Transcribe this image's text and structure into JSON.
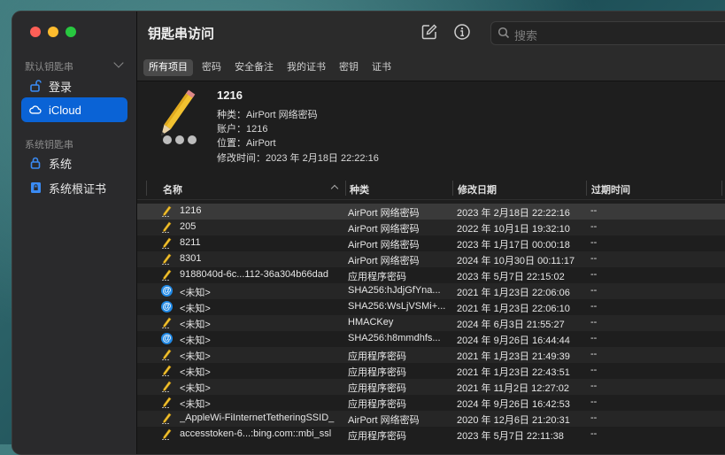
{
  "window": {
    "title": "钥匙串访问"
  },
  "sidebar": {
    "section_default": "默认钥匙串",
    "section_system": "系统钥匙串",
    "items": [
      {
        "label": "登录",
        "icon": "unlocked-lock-icon"
      },
      {
        "label": "iCloud",
        "icon": "cloud-icon",
        "selected": true
      },
      {
        "label": "系统",
        "icon": "lock-icon"
      },
      {
        "label": "系统根证书",
        "icon": "locked-cabinet-icon"
      }
    ]
  },
  "toolbar": {
    "search_placeholder": "搜索"
  },
  "filters": [
    "所有项目",
    "密码",
    "安全备注",
    "我的证书",
    "密钥",
    "证书"
  ],
  "detail": {
    "name": "1216",
    "kind": "种类：AirPort 网络密码",
    "account": "账户：1216",
    "where": "位置：AirPort",
    "modified": "修改时间：2023 年 2月18日 22:22:16"
  },
  "columns": {
    "name": "名称",
    "kind": "种类",
    "date": "修改日期",
    "expires": "过期时间"
  },
  "rows": [
    {
      "icon": "pencil",
      "name": "1216",
      "kind": "AirPort 网络密码",
      "date": "2023 年 2月18日 22:22:16",
      "exp": "--"
    },
    {
      "icon": "pencil",
      "name": "205",
      "kind": "AirPort 网络密码",
      "date": "2022 年 10月1日 19:32:10",
      "exp": "--"
    },
    {
      "icon": "pencil",
      "name": "8211",
      "kind": "AirPort 网络密码",
      "date": "2023 年 1月17日 00:00:18",
      "exp": "--"
    },
    {
      "icon": "pencil",
      "name": "8301",
      "kind": "AirPort 网络密码",
      "date": "2024 年 10月30日 00:11:17",
      "exp": "--"
    },
    {
      "icon": "pencil",
      "name": "9188040d-6c...112-36a304b66dad",
      "kind": "应用程序密码",
      "date": "2023 年 5月7日 22:15:02",
      "exp": "--"
    },
    {
      "icon": "at",
      "name": "<未知>",
      "kind": "SHA256:hJdjGfYna...",
      "date": "2021 年 1月23日 22:06:06",
      "exp": "--"
    },
    {
      "icon": "at",
      "name": "<未知>",
      "kind": "SHA256:WsLjVSMi+...",
      "date": "2021 年 1月23日 22:06:10",
      "exp": "--"
    },
    {
      "icon": "pencil",
      "name": "<未知>",
      "kind": "HMACKey",
      "date": "2024 年 6月3日 21:55:27",
      "exp": "--"
    },
    {
      "icon": "at",
      "name": "<未知>",
      "kind": "SHA256:h8mmdhfs...",
      "date": "2024 年 9月26日 16:44:44",
      "exp": "--"
    },
    {
      "icon": "pencil",
      "name": "<未知>",
      "kind": "应用程序密码",
      "date": "2021 年 1月23日 21:49:39",
      "exp": "--"
    },
    {
      "icon": "pencil",
      "name": "<未知>",
      "kind": "应用程序密码",
      "date": "2021 年 1月23日 22:43:51",
      "exp": "--"
    },
    {
      "icon": "pencil",
      "name": "<未知>",
      "kind": "应用程序密码",
      "date": "2021 年 11月2日 12:27:02",
      "exp": "--"
    },
    {
      "icon": "pencil",
      "name": "<未知>",
      "kind": "应用程序密码",
      "date": "2024 年 9月26日 16:42:53",
      "exp": "--"
    },
    {
      "icon": "pencil",
      "name": "_AppleWi-FiInternetTetheringSSID_",
      "kind": "AirPort 网络密码",
      "date": "2020 年 12月6日 21:20:31",
      "exp": "--"
    },
    {
      "icon": "pencil",
      "name": "accesstoken-6...:bing.com::mbi_ssl",
      "kind": "应用程序密码",
      "date": "2023 年 5月7日 22:11:38",
      "exp": "--"
    }
  ]
}
